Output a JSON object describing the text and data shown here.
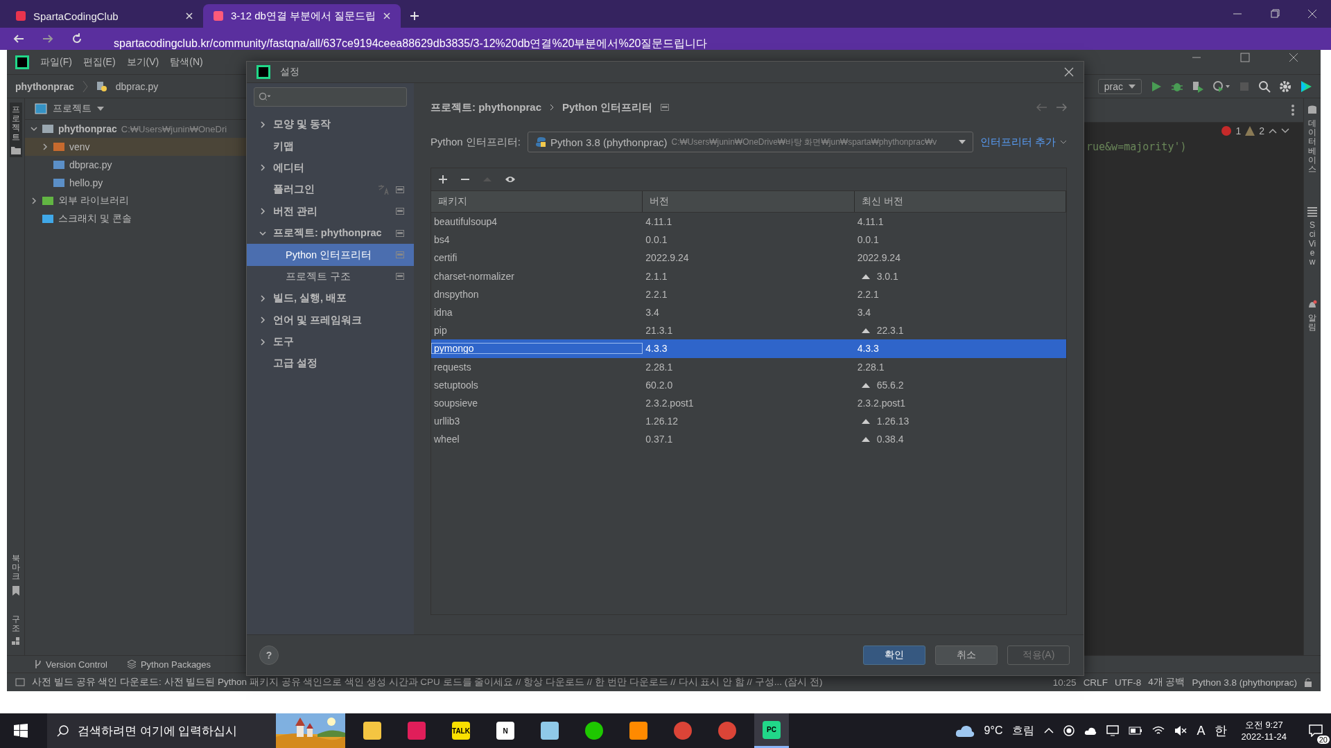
{
  "browser": {
    "tabs": [
      {
        "title": "SpartaCodingClub",
        "selected": false
      },
      {
        "title": "3-12 db연결 부분에서 질문드립",
        "selected": true
      }
    ],
    "url": "spartacodingclub.kr/community/fastqna/all/637ce9194ceea88629db3835/3-12%20db연결%20부분에서%20질문드립니다"
  },
  "ide": {
    "menu": [
      "파일(F)",
      "편집(E)",
      "보기(V)",
      "탐색(N)"
    ],
    "breadcrumb": [
      "phythonprac",
      "dbprac.py"
    ],
    "run_config": "prac",
    "left_strip": [
      {
        "label": "프로젝트",
        "kind": "folder"
      },
      {
        "label": "북마크",
        "kind": "bookmark"
      },
      {
        "label": "구조",
        "kind": "structure"
      }
    ],
    "project_panel": {
      "title": "프로젝트",
      "tree": [
        {
          "label": "phythonprac",
          "detail": "C:₩Users₩junin₩OneDri",
          "kind": "folder",
          "expanded": true,
          "selected": false,
          "children": [
            {
              "label": "venv",
              "kind": "venv",
              "expanded": false,
              "selected": true
            },
            {
              "label": "dbprac.py",
              "kind": "python",
              "selected": false
            },
            {
              "label": "hello.py",
              "kind": "python",
              "selected": false
            }
          ]
        },
        {
          "label": "외부 라이브러리",
          "kind": "library",
          "expanded": false,
          "selected": false
        },
        {
          "label": "스크래치 및 콘솔",
          "kind": "scratch",
          "selected": false
        }
      ]
    },
    "editor": {
      "code": "rue&w=majority')",
      "errors": "1",
      "warnings": "2"
    },
    "right_strip": [
      {
        "label": "데이터베이스",
        "kind": "database"
      },
      {
        "label": "SciView",
        "kind": "grid"
      },
      {
        "label": "알림",
        "kind": "bell"
      }
    ],
    "tool_tabs": [
      {
        "label": "Version Control",
        "kind": "branch"
      },
      {
        "label": "Python Packages",
        "kind": "layers"
      }
    ],
    "status_bar": {
      "message": "사전 빌드 공유 색인 다운로드: 사전 빌드된 Python 패키지 공유 색인으로 색인 생성 시간과 CPU 로드를 줄이세요 // 항상 다운로드 // 한 번만 다운로드 // 다시 표시 안 함 // 구성... (잠시 전)",
      "items": [
        "10:25",
        "CRLF",
        "UTF-8",
        "4개 공백",
        "Python 3.8 (phythonprac)"
      ]
    }
  },
  "dialog": {
    "title": "설정",
    "sidebar": [
      {
        "label": "모양 및 동작",
        "expandable": true,
        "expanded": false,
        "selected": false,
        "scoped": false,
        "translate": false
      },
      {
        "label": "키맵",
        "expandable": false,
        "selected": false,
        "scoped": false,
        "translate": false
      },
      {
        "label": "에디터",
        "expandable": true,
        "expanded": false,
        "selected": false,
        "scoped": false,
        "translate": false
      },
      {
        "label": "플러그인",
        "expandable": false,
        "selected": false,
        "scoped": true,
        "translate": true
      },
      {
        "label": "버전 관리",
        "expandable": true,
        "expanded": false,
        "selected": false,
        "scoped": true,
        "translate": false
      },
      {
        "label": "프로젝트: phythonprac",
        "expandable": true,
        "expanded": true,
        "selected": false,
        "scoped": true,
        "translate": false,
        "children": [
          {
            "label": "Python 인터프리터",
            "selected": true,
            "scoped": true
          },
          {
            "label": "프로젝트 구조",
            "selected": false,
            "scoped": true
          }
        ]
      },
      {
        "label": "빌드, 실행, 배포",
        "expandable": true,
        "expanded": false,
        "selected": false,
        "scoped": false,
        "translate": false
      },
      {
        "label": "언어 및 프레임워크",
        "expandable": true,
        "expanded": false,
        "selected": false,
        "scoped": false,
        "translate": false
      },
      {
        "label": "도구",
        "expandable": true,
        "expanded": false,
        "selected": false,
        "scoped": false,
        "translate": false
      },
      {
        "label": "고급 설정",
        "expandable": false,
        "selected": false,
        "scoped": false,
        "translate": false
      }
    ],
    "path": [
      "프로젝트: phythonprac",
      "Python 인터프리터"
    ],
    "interpreter_label": "Python 인터프리터:",
    "interpreter": {
      "name": "Python 3.8 (phythonprac)",
      "path": "C:₩Users₩junin₩OneDrive₩바탕 화면₩jun₩sparta₩phythonprac₩v"
    },
    "add_interpreter": "인터프리터 추가",
    "columns": [
      "패키지",
      "버전",
      "최신 버전"
    ],
    "packages": [
      {
        "name": "beautifulsoup4",
        "version": "4.11.1",
        "latest": "4.11.1",
        "upgrade": false,
        "selected": false
      },
      {
        "name": "bs4",
        "version": "0.0.1",
        "latest": "0.0.1",
        "upgrade": false,
        "selected": false
      },
      {
        "name": "certifi",
        "version": "2022.9.24",
        "latest": "2022.9.24",
        "upgrade": false,
        "selected": false
      },
      {
        "name": "charset-normalizer",
        "version": "2.1.1",
        "latest": "3.0.1",
        "upgrade": true,
        "selected": false
      },
      {
        "name": "dnspython",
        "version": "2.2.1",
        "latest": "2.2.1",
        "upgrade": false,
        "selected": false
      },
      {
        "name": "idna",
        "version": "3.4",
        "latest": "3.4",
        "upgrade": false,
        "selected": false
      },
      {
        "name": "pip",
        "version": "21.3.1",
        "latest": "22.3.1",
        "upgrade": true,
        "selected": false
      },
      {
        "name": "pymongo",
        "version": "4.3.3",
        "latest": "4.3.3",
        "upgrade": false,
        "selected": true
      },
      {
        "name": "requests",
        "version": "2.28.1",
        "latest": "2.28.1",
        "upgrade": false,
        "selected": false
      },
      {
        "name": "setuptools",
        "version": "60.2.0",
        "latest": "65.6.2",
        "upgrade": true,
        "selected": false
      },
      {
        "name": "soupsieve",
        "version": "2.3.2.post1",
        "latest": "2.3.2.post1",
        "upgrade": false,
        "selected": false
      },
      {
        "name": "urllib3",
        "version": "1.26.12",
        "latest": "1.26.13",
        "upgrade": true,
        "selected": false
      },
      {
        "name": "wheel",
        "version": "0.37.1",
        "latest": "0.38.4",
        "upgrade": true,
        "selected": false
      }
    ],
    "help": "?",
    "buttons": [
      {
        "label": "확인",
        "kind": "primary"
      },
      {
        "label": "취소",
        "kind": "normal"
      },
      {
        "label": "적용(A)",
        "kind": "disabled"
      }
    ]
  },
  "taskbar": {
    "search_placeholder": "검색하려면 여기에 입력하십시",
    "weather": "9°C",
    "weather_text": "흐림",
    "ime_mode": "A",
    "ime_lang": "한",
    "time": "오전 9:27",
    "date": "2022-11-24",
    "notifications": "20",
    "apps": [
      {
        "kind": "folder"
      },
      {
        "kind": "slack"
      },
      {
        "kind": "talk",
        "label": "TALK"
      },
      {
        "kind": "notion",
        "label": "N"
      },
      {
        "kind": "note"
      },
      {
        "kind": "ring"
      },
      {
        "kind": "camera"
      },
      {
        "kind": "chrome"
      },
      {
        "kind": "chrome"
      },
      {
        "kind": "pycharm",
        "label": "PC",
        "selected": true
      }
    ]
  }
}
